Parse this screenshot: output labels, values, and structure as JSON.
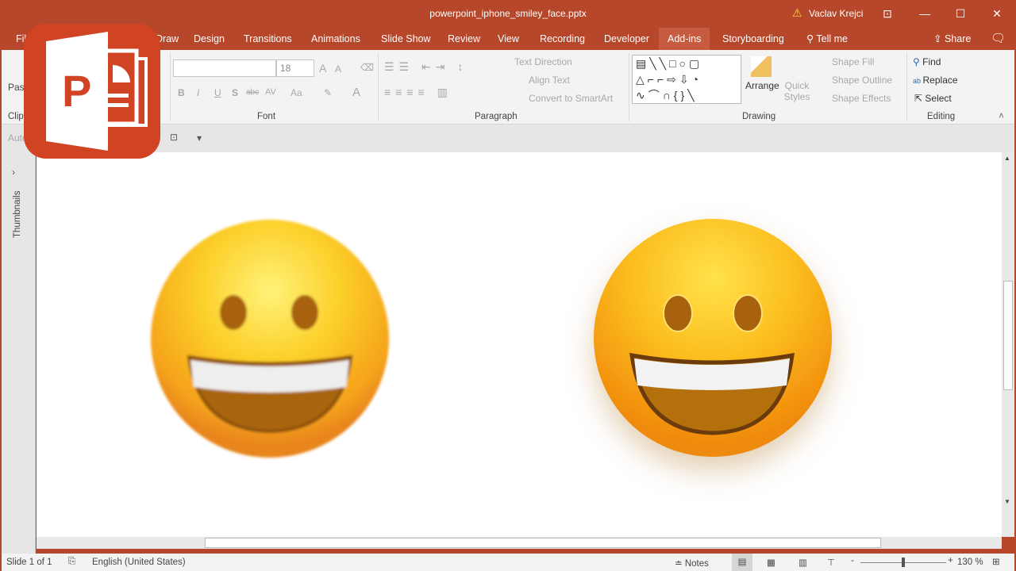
{
  "window": {
    "title": "powerpoint_iphone_smiley_face.pptx",
    "user": "Vaclav Krejci",
    "warning_icon": "warning-icon",
    "accent": "#b7472a"
  },
  "tabs": [
    {
      "label": "File"
    },
    {
      "label": "Draw"
    },
    {
      "label": "Design"
    },
    {
      "label": "Transitions"
    },
    {
      "label": "Animations"
    },
    {
      "label": "Slide Show"
    },
    {
      "label": "Review"
    },
    {
      "label": "View"
    },
    {
      "label": "Recording"
    },
    {
      "label": "Developer"
    },
    {
      "label": "Add-ins",
      "active": true
    },
    {
      "label": "Storyboarding"
    },
    {
      "label": "Tell me"
    }
  ],
  "share": "Share",
  "ribbon": {
    "clipboard": {
      "paste": "Paste",
      "label": "Clipboard"
    },
    "font": {
      "label": "Font",
      "font_name": "",
      "font_size": "18",
      "bold": "B",
      "italic": "I",
      "underline": "U",
      "shadow": "S",
      "strike": "abc",
      "spacing": "AV",
      "case": "Aa",
      "color": "A",
      "grow": "A",
      "shrink": "A"
    },
    "paragraph": {
      "label": "Paragraph",
      "text_direction": "Text Direction",
      "align_text": "Align Text",
      "smartart": "Convert to SmartArt"
    },
    "drawing": {
      "label": "Drawing",
      "arrange": "Arrange",
      "quick_styles": "Quick Styles",
      "shape_fill": "Shape Fill",
      "shape_outline": "Shape Outline",
      "shape_effects": "Shape Effects"
    },
    "editing": {
      "label": "Editing",
      "find": "Find",
      "replace": "Replace",
      "select": "Select"
    }
  },
  "qat": {
    "autosave": "AutoSave"
  },
  "leftpane": {
    "label": "Thumbnails"
  },
  "status": {
    "slide": "Slide 1 of 1",
    "language": "English (United States)",
    "notes": "Notes",
    "zoom": "130 %",
    "zoom_level": 130
  }
}
